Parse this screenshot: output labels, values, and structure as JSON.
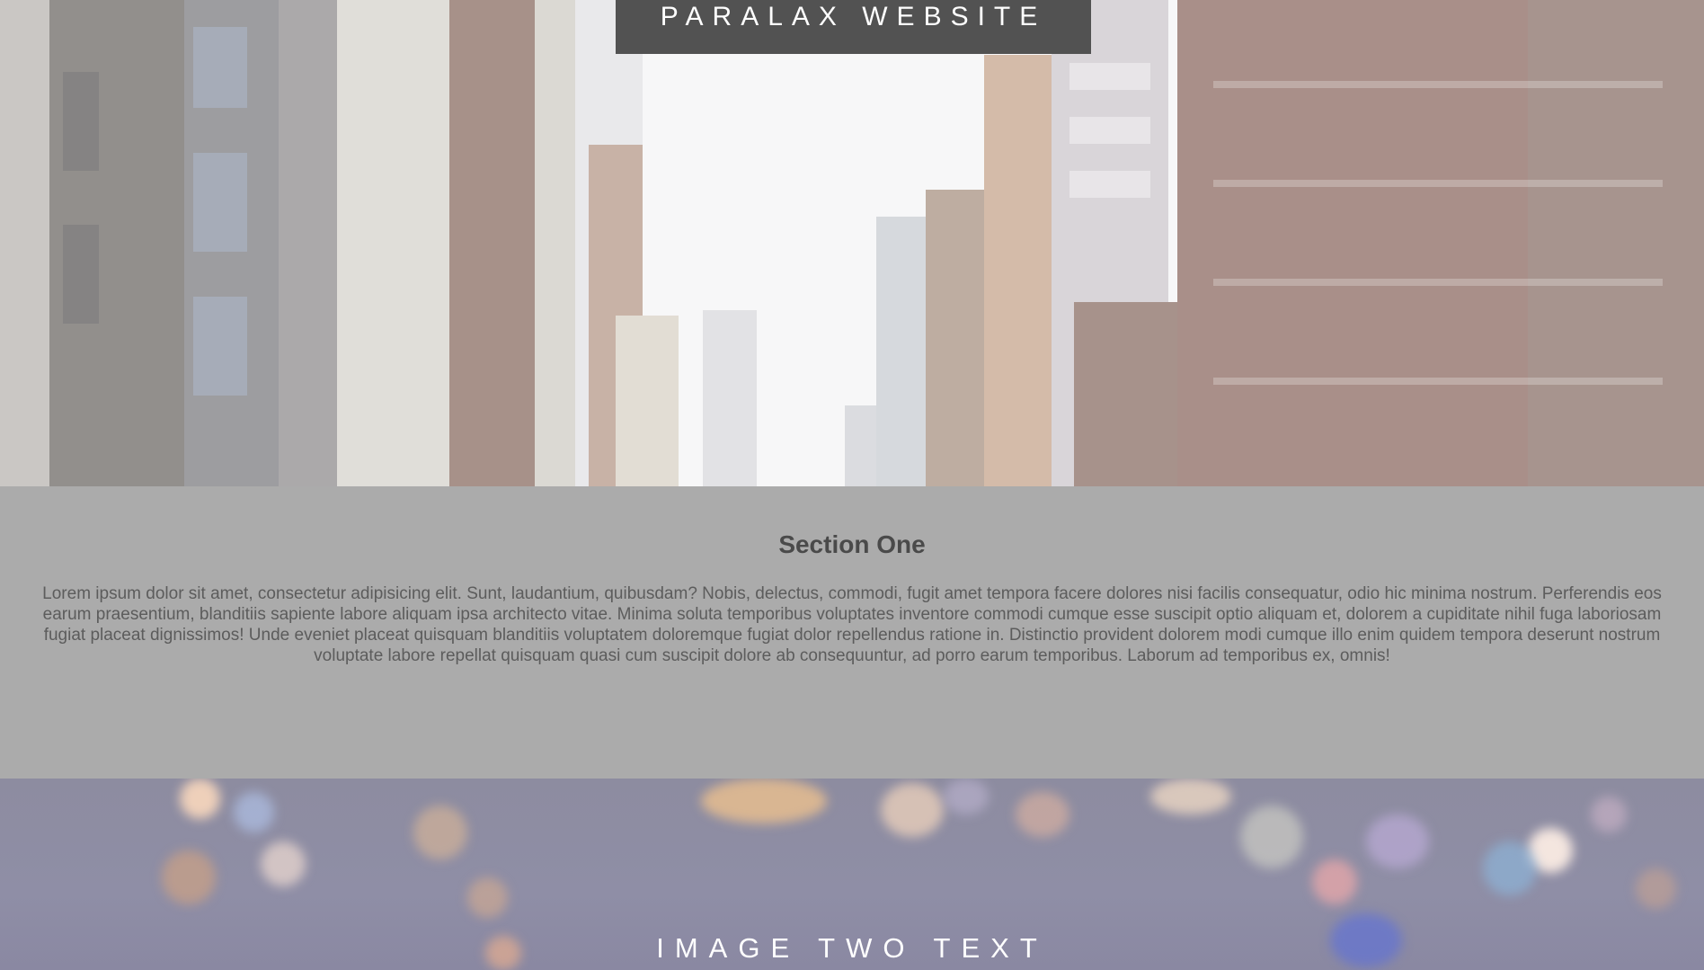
{
  "header": {
    "title": "PARALAX WEBSITE"
  },
  "section_one": {
    "heading": "Section One",
    "body": "Lorem ipsum dolor sit amet, consectetur adipisicing elit. Sunt, laudantium, quibusdam? Nobis, delectus, commodi, fugit amet tempora facere dolores nisi facilis consequatur, odio hic minima nostrum. Perferendis eos earum praesentium, blanditiis sapiente labore aliquam ipsa architecto vitae. Minima soluta temporibus voluptates inventore commodi cumque esse suscipit optio aliquam et, dolorem a cupiditate nihil fuga laboriosam fugiat placeat dignissimos! Unde eveniet placeat quisquam blanditiis voluptatem doloremque fugiat dolor repellendus ratione in. Distinctio provident dolorem modi cumque illo enim quidem tempora deserunt nostrum voluptate labore repellat quisquam quasi cum suscipit dolore ab consequuntur, ad porro earum temporibus. Laborum ad temporibus ex, omnis!"
  },
  "image_two": {
    "text": "IMAGE TWO TEXT"
  },
  "colors": {
    "title_box": "#525252",
    "section_bg": "#ababab",
    "heading": "#4a4a4a",
    "body_text": "#5c5c5c"
  }
}
